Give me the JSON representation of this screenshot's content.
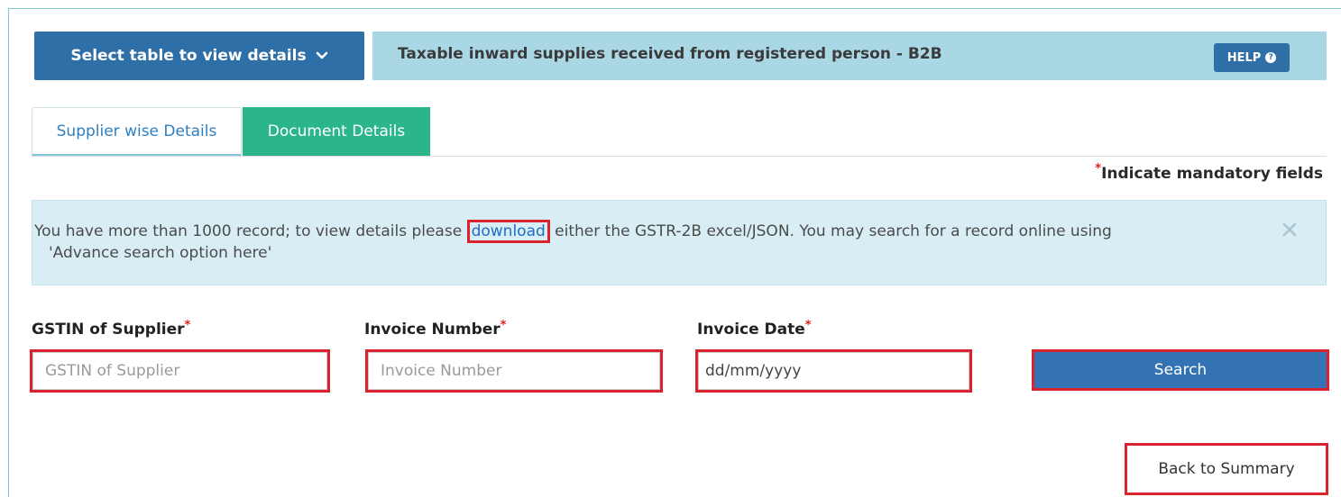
{
  "select_table": {
    "label": "Select table to view details",
    "icon": "chevron-down-icon"
  },
  "header": {
    "title": "Taxable inward supplies received from registered person - B2B",
    "help_label": "HELP",
    "help_icon": "question-circle-icon",
    "background_color": "#a9d7e4"
  },
  "tabs": [
    {
      "label": "Supplier wise Details",
      "active": false
    },
    {
      "label": "Document Details",
      "active": true
    }
  ],
  "mandatory_note": "Indicate mandatory fields",
  "mandatory_star": "*",
  "info": {
    "text_before": "You have more than 1000 record; to view details please ",
    "link_text": "download",
    "text_after": " either the GSTR-2B excel/JSON. You may search for a record online using",
    "text_line2": "'Advance search option here'",
    "close_icon": "close-icon"
  },
  "form": {
    "gstin": {
      "label": "GSTIN of Supplier",
      "placeholder": "GSTIN of Supplier",
      "value": ""
    },
    "invoice_number": {
      "label": "Invoice Number",
      "placeholder": "Invoice Number",
      "value": ""
    },
    "invoice_date": {
      "label": "Invoice Date",
      "placeholder": "dd/mm/yyyy",
      "value": ""
    },
    "search_label": "Search"
  },
  "back_label": "Back to Summary",
  "colors": {
    "primary_blue": "#2f6fa8",
    "tab_active_green": "#2bb58a",
    "highlight_red": "#d9232e",
    "info_bg": "#d8edf4"
  }
}
